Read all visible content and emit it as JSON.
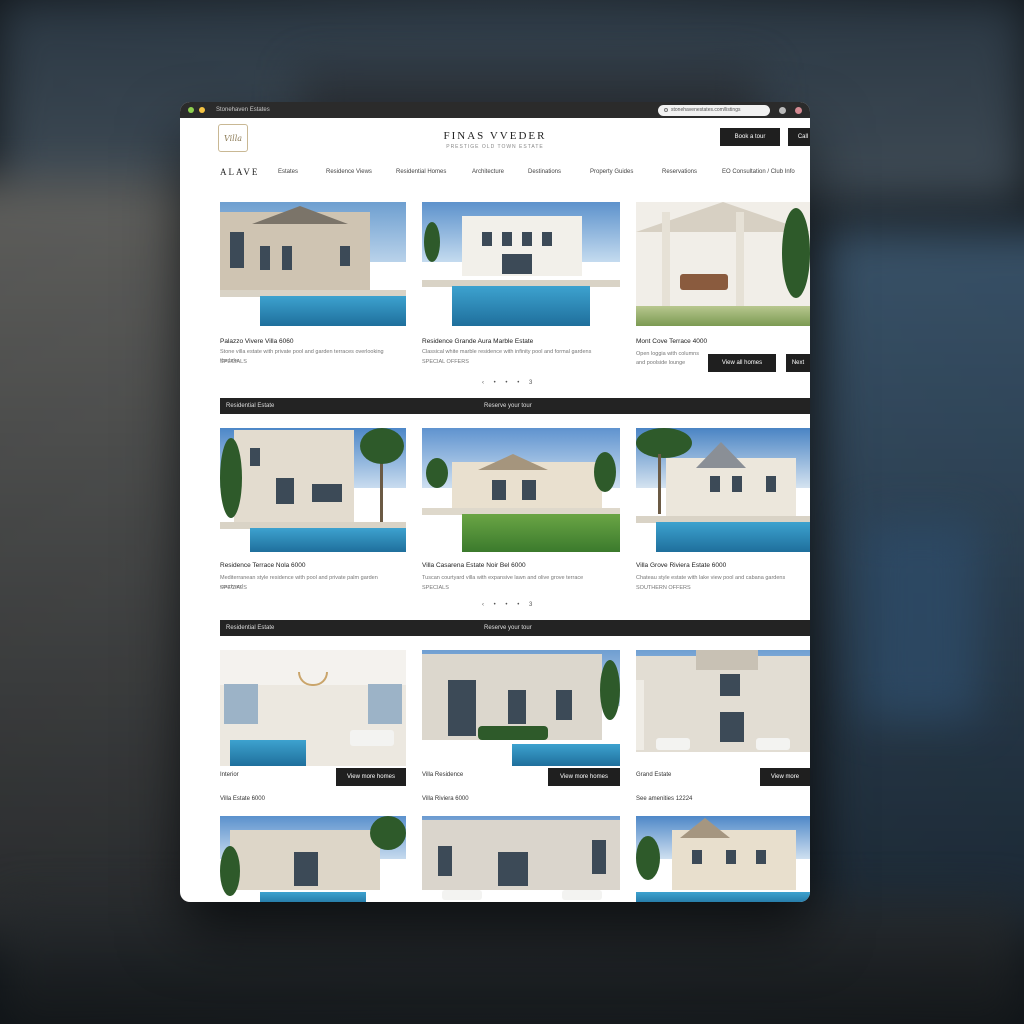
{
  "titlebar": {
    "title": "Stonehaven Estates",
    "url": "stonehavenestates.com/listings"
  },
  "header": {
    "logo_text": "Villa",
    "brand": "FINAS VVEDER",
    "tagline": "PRESTIGE OLD TOWN ESTATE",
    "btn_primary": "Book a tour",
    "btn_secondary": "Call"
  },
  "nav": {
    "brand": "ALAVE",
    "items": [
      "Estates",
      "Residence Views",
      "Residential Homes",
      "Architecture",
      "Destinations",
      "Property Guides",
      "Reservations",
      "EO Consultation / Club Info"
    ]
  },
  "section1": {
    "cards": [
      {
        "title": "Palazzo Vivere Villa 6060",
        "text": "Stone villa estate with private pool and garden terraces overlooking the lake",
        "extra": "SPECIALS"
      },
      {
        "title": "Residence Grande Aura Marble Estate",
        "text": "Classical white marble residence with infinity pool and formal gardens",
        "extra": "SPECIAL OFFERS"
      },
      {
        "title": "Mont Cove Terrace 4000",
        "text": "Open loggia with columns and poolside lounge",
        "extra": ""
      }
    ],
    "pager": "‹  •  •  •  3",
    "btn_view": "View all homes",
    "btn_more": "Next"
  },
  "bar1": {
    "left": "Residential Estate",
    "center": "Reserve your tour"
  },
  "section2": {
    "cards": [
      {
        "title": "Residence Terrace Nola 6000",
        "text": "Mediterranean style residence with pool and private palm garden courtyard",
        "extra": "SPECIALS"
      },
      {
        "title": "Villa Casarena Estate Noir Bel 6000",
        "text": "Tuscan courtyard villa with expansive lawn and olive grove terrace",
        "extra": "SPECIALS"
      },
      {
        "title": "Villa Grove Riviera Estate 6000",
        "text": "Chateau style estate with lake view pool and cabana gardens",
        "extra": "SOUTHERN OFFERS"
      }
    ],
    "pager": "‹  •  •  •  3"
  },
  "bar2": {
    "left": "Residential Estate",
    "center": "Reserve your tour"
  },
  "section3": {
    "cards": [
      {
        "label": "Interior",
        "btn": "View more homes",
        "price": "Villa Estate 6000"
      },
      {
        "label": "Villa Residence",
        "btn": "View more homes",
        "price": "Villa Riviera 6000"
      },
      {
        "label": "Grand Estate",
        "btn": "View more",
        "price": "See amenities 12224"
      }
    ]
  },
  "colors": {
    "accent": "#1f1f1f",
    "pool": "#2f8fbf",
    "bar": "#232323"
  }
}
